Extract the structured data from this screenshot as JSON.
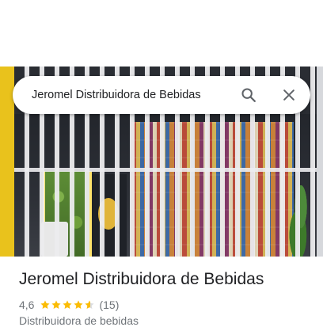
{
  "search": {
    "query": "Jeromel Distribuidora de Bebidas"
  },
  "icons": {
    "search": "search-icon",
    "close": "close-icon",
    "star": "star-icon"
  },
  "place": {
    "name": "Jeromel Distribuidora de Bebidas",
    "rating": "4,6",
    "rating_value": 4.6,
    "stars_max": 5,
    "review_count": "(15)",
    "category": "Distribuidora de bebidas"
  },
  "colors": {
    "star": "#fbbc04",
    "text_primary": "#202124",
    "text_secondary": "#70757a"
  }
}
